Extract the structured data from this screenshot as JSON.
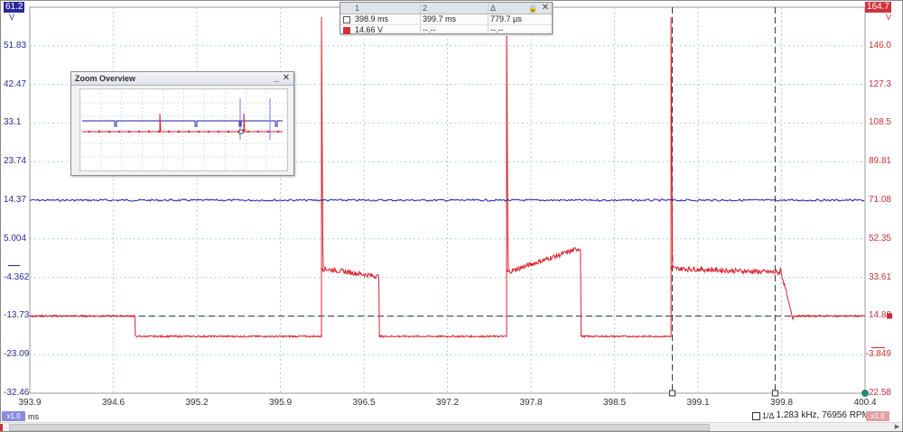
{
  "left_axis": {
    "top_value": "61.2",
    "unit": "V",
    "ticks": [
      "51.83",
      "42.47",
      "33.1",
      "23.74",
      "14.37",
      "5.004",
      "-4.362",
      "-13.73",
      "-23.09",
      "-32.46"
    ],
    "min": -32.46,
    "max": 61.2,
    "color": "#2a2a9a"
  },
  "right_axis": {
    "top_value": "164.7",
    "unit": "V",
    "ticks": [
      "146.0",
      "127.3",
      "108.5",
      "89.81",
      "71.08",
      "52.35",
      "33.61",
      "14.88",
      "-3.849",
      "-22.58"
    ],
    "min": -22.58,
    "max": 164.7,
    "color": "#c83238"
  },
  "x_axis": {
    "ticks": [
      "393.9",
      "394.6",
      "395.2",
      "395.9",
      "396.5",
      "397.2",
      "397.8",
      "398.5",
      "399.1",
      "399.8",
      "400.4"
    ],
    "unit": "ms",
    "min": 393.9,
    "max": 400.4,
    "range_chip": "x1.0"
  },
  "measurements": {
    "headers": [
      "1",
      "2",
      "Δ"
    ],
    "rows": [
      {
        "v1": "398.9 ms",
        "v2": "399.7 ms",
        "delta": "779.7 μs"
      },
      {
        "v1": "14.66 V",
        "v2": "--.--",
        "delta": "--.--"
      }
    ]
  },
  "zoom_overview": {
    "title": "Zoom Overview",
    "minimize": "_",
    "close": "✕"
  },
  "status": {
    "cursor_mode": "1/Δ",
    "frequency": "1.283 kHz, 76956 RPM",
    "right_chip": "x1.0"
  },
  "signals": {
    "blue_level_v": 14.37,
    "red_baseline_v": 14.88,
    "red_low_v": 5.0,
    "red_plateau_v": 38.0,
    "red_spike_v": 160.0,
    "red_spikes_ms": [
      396.17,
      397.61,
      398.89
    ],
    "red_low_segments_ms": [
      [
        394.72,
        396.17
      ],
      [
        396.62,
        397.61
      ],
      [
        398.19,
        398.89
      ]
    ],
    "cursor1_ms": 398.9,
    "cursor2_ms": 399.7,
    "ruler_v": 14.88
  },
  "colors": {
    "blue_trace": "#1f1fa8",
    "red_trace": "#d8232f",
    "grid": "#a9d6d2",
    "cursor": "#333333",
    "trigger": "#1f8f7f"
  },
  "icons": {
    "cursor-box": "□",
    "lock": "🔒",
    "freq-icon": "□"
  }
}
